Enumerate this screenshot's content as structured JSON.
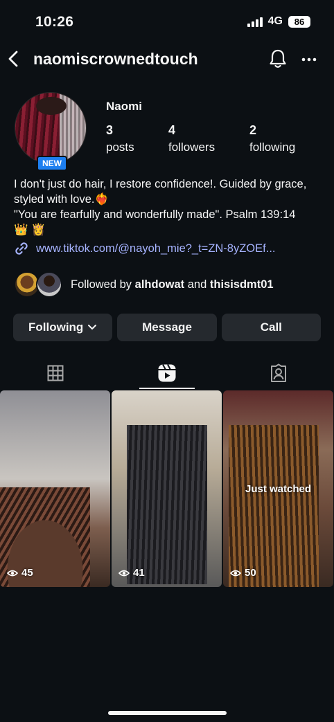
{
  "status_bar": {
    "time": "10:26",
    "network": "4G",
    "battery": "86"
  },
  "header": {
    "username": "naomiscrownedtouch"
  },
  "profile": {
    "display_name": "Naomi",
    "new_badge": "NEW",
    "stats": [
      {
        "value": "3",
        "label": "posts"
      },
      {
        "value": "4",
        "label": "followers"
      },
      {
        "value": "2",
        "label": "following"
      }
    ],
    "bio_line1": "I don't just do hair, I restore confidence!. Guided by grace, styled with love.",
    "bio_emoji1": "❤️‍🔥",
    "bio_line2": "\"You are fearfully and wonderfully made\". Psalm 139:14",
    "bio_emoji2": "👑 👸",
    "link": "www.tiktok.com/@nayoh_mie?_t=ZN-8yZOEf..."
  },
  "followed_by": {
    "prefix": "Followed by",
    "user1": "alhdowat",
    "conjunction": "and",
    "user2": "thisisdmt01"
  },
  "buttons": {
    "following": "Following",
    "message": "Message",
    "call": "Call"
  },
  "tabs": [
    {
      "icon": "grid-icon",
      "active": false
    },
    {
      "icon": "reels-icon",
      "active": true
    },
    {
      "icon": "tagged-icon",
      "active": false
    }
  ],
  "reels": [
    {
      "views": "45",
      "overlay": ""
    },
    {
      "views": "41",
      "overlay": ""
    },
    {
      "views": "50",
      "overlay": "Just watched"
    }
  ],
  "colors": {
    "background": "#0c1014",
    "button": "#25292e",
    "link": "#a6b3ff",
    "badge": "#1d7ff0"
  }
}
